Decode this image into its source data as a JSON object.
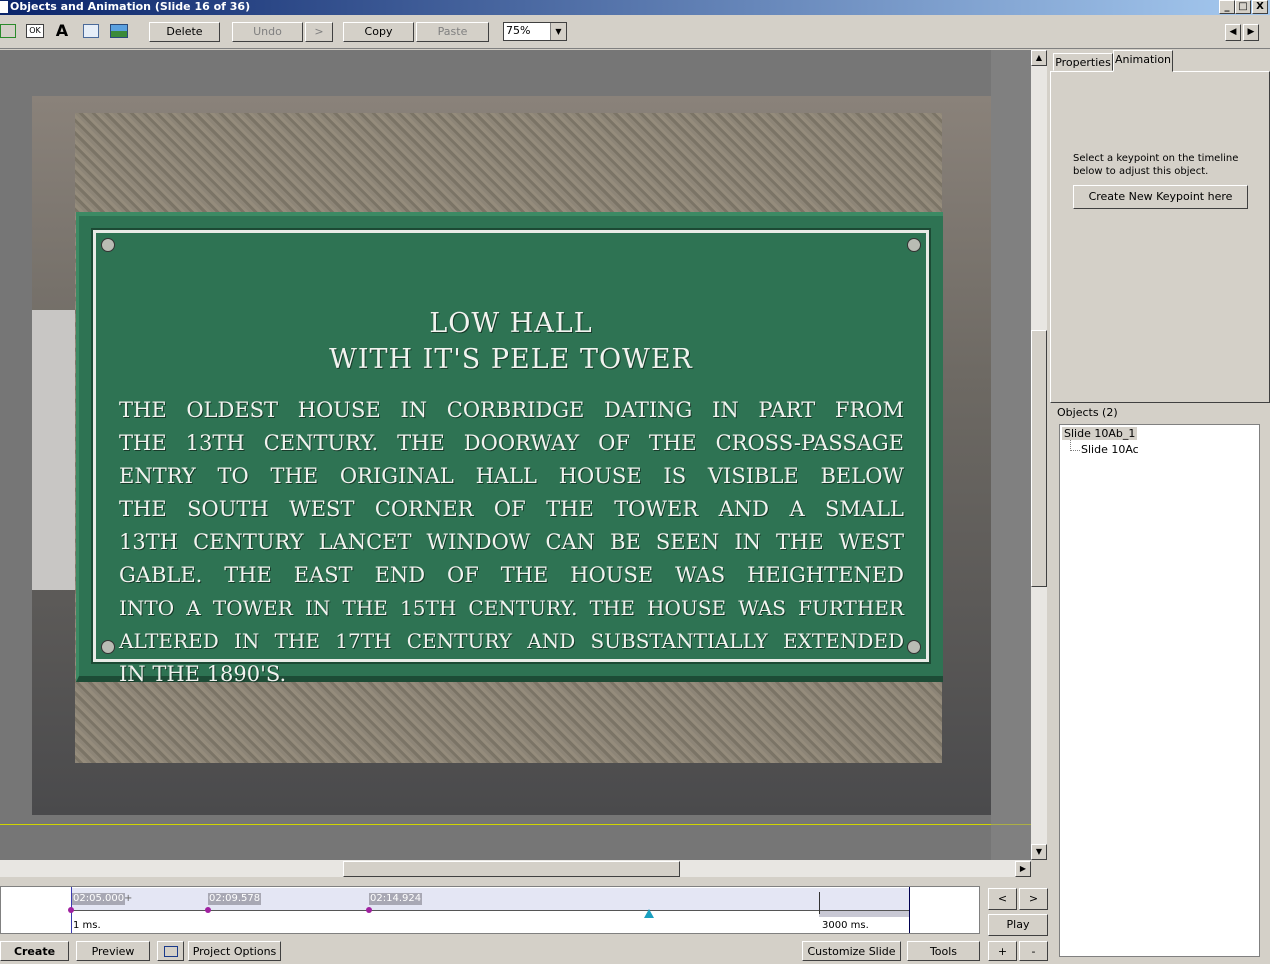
{
  "window": {
    "title": "Objects and Animation  (Slide 16 of 36)",
    "controls": [
      "_",
      "□",
      "X"
    ]
  },
  "toolbar": {
    "icons": [
      "rectangle-icon",
      "ok-button-icon",
      "text-icon",
      "shape-icon",
      "image-icon"
    ],
    "text_icon_glyph": "A",
    "ok_icon_label": "OK",
    "delete_label": "Delete",
    "undo_label": "Undo",
    "redo_label": ">",
    "copy_label": "Copy",
    "paste_label": "Paste",
    "zoom_value": "75%",
    "nav_prev": "◀",
    "nav_next": "▶"
  },
  "slide": {
    "plaque_title_1": "LOW HALL",
    "plaque_title_2": "WITH IT'S PELE TOWER",
    "plaque_lines": [
      "THE OLDEST HOUSE IN CORBRIDGE DATING IN PART FROM",
      "THE 13TH CENTURY. THE DOORWAY OF THE CROSS-PASSAGE",
      "ENTRY TO THE ORIGINAL HALL HOUSE IS VISIBLE BELOW",
      "THE SOUTH WEST CORNER OF THE TOWER AND A SMALL",
      "13TH CENTURY LANCET WINDOW CAN BE SEEN IN THE WEST",
      "GABLE. THE EAST END OF THE HOUSE WAS HEIGHTENED",
      "INTO A TOWER IN THE 15TH CENTURY. THE HOUSE WAS FURTHER",
      "ALTERED IN THE 17TH CENTURY AND SUBSTANTIALLY EXTENDED",
      "IN THE 1890'S."
    ]
  },
  "right_panel": {
    "tabs": [
      "Properties",
      "Animation"
    ],
    "active_tab": "Animation",
    "hint": "Select a keypoint on the timeline below to adjust this object.",
    "keypoint_button": "Create New Keypoint here",
    "objects_label": "Objects (2)",
    "objects": [
      "Slide 10Ab_1",
      "Slide 10Ac"
    ]
  },
  "timeline": {
    "keypoints": [
      "02:05.000",
      "02:09.578",
      "02:14.924"
    ],
    "keypoint_marker": "+",
    "start_label": "1 ms.",
    "end_label": "3000 ms.",
    "playhead_fraction": 0.69
  },
  "playback": {
    "prev": "<",
    "next": ">",
    "play": "Play",
    "plus": "+",
    "minus": "-"
  },
  "bottom_bar": {
    "create": "Create",
    "preview": "Preview",
    "project_options": "Project Options",
    "customize_slide": "Customize Slide",
    "tools": "Tools"
  }
}
